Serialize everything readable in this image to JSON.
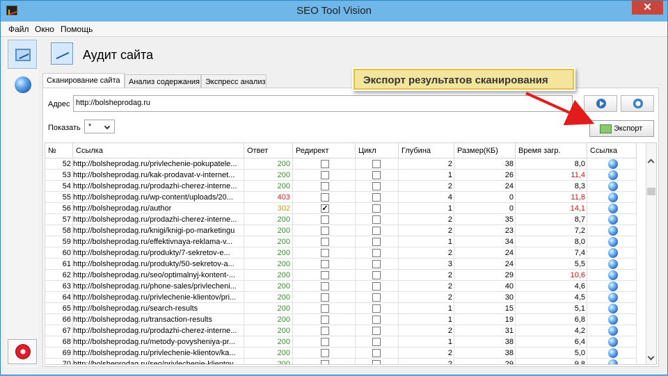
{
  "window": {
    "title": "SEO Tool Vision",
    "close": "✕"
  },
  "menu": [
    "Файл",
    "Окно",
    "Помощь"
  ],
  "header": {
    "title": "Аудит сайта"
  },
  "tabs": [
    "Сканирование сайта",
    "Анализ содержания",
    "Экспресс анализ"
  ],
  "form": {
    "address_label": "Адрес",
    "address_value": "http://bolsheprodag.ru",
    "show_label": "Показать",
    "show_value": "*",
    "export_label": "Экспорт"
  },
  "callout": {
    "text": "Экспорт результатов сканирования"
  },
  "table": {
    "headers": [
      "№",
      "Ссылка",
      "Ответ",
      "Редирект",
      "Цикл",
      "Глубина",
      "Размер(КБ)",
      "Время загр.",
      "Ссылка"
    ],
    "rows": [
      {
        "n": "52",
        "url": "http://bolsheprodag.ru/privlechenie-pokupatele...",
        "resp": "200",
        "redir": false,
        "cycle": false,
        "depth": "2",
        "size": "38",
        "time": "8,0"
      },
      {
        "n": "53",
        "url": "http://bolsheprodag.ru/kak-prodavat-v-internet...",
        "resp": "200",
        "redir": false,
        "cycle": false,
        "depth": "1",
        "size": "26",
        "time": "11,4"
      },
      {
        "n": "54",
        "url": "http://bolsheprodag.ru/prodazhi-cherez-interne...",
        "resp": "200",
        "redir": false,
        "cycle": false,
        "depth": "2",
        "size": "24",
        "time": "8,3"
      },
      {
        "n": "55",
        "url": "http://bolsheprodag.ru/wp-content/uploads/20...",
        "resp": "403",
        "redir": false,
        "cycle": false,
        "depth": "4",
        "size": "0",
        "time": "11,8"
      },
      {
        "n": "56",
        "url": "http://bolsheprodag.ru/author",
        "resp": "302",
        "redir": true,
        "cycle": false,
        "depth": "1",
        "size": "0",
        "time": "14,1"
      },
      {
        "n": "57",
        "url": "http://bolsheprodag.ru/prodazhi-cherez-interne...",
        "resp": "200",
        "redir": false,
        "cycle": false,
        "depth": "2",
        "size": "35",
        "time": "8,7"
      },
      {
        "n": "58",
        "url": "http://bolsheprodag.ru/knigi/knigi-po-marketingu",
        "resp": "200",
        "redir": false,
        "cycle": false,
        "depth": "2",
        "size": "23",
        "time": "7,2"
      },
      {
        "n": "59",
        "url": "http://bolsheprodag.ru/effektivnaya-reklama-v...",
        "resp": "200",
        "redir": false,
        "cycle": false,
        "depth": "1",
        "size": "34",
        "time": "8,0"
      },
      {
        "n": "60",
        "url": "http://bolsheprodag.ru/produkty/7-sekretov-e...",
        "resp": "200",
        "redir": false,
        "cycle": false,
        "depth": "2",
        "size": "24",
        "time": "7,4"
      },
      {
        "n": "61",
        "url": "http://bolsheprodag.ru/produkty/50-sekretov-a...",
        "resp": "200",
        "redir": false,
        "cycle": false,
        "depth": "3",
        "size": "24",
        "time": "5,5"
      },
      {
        "n": "62",
        "url": "http://bolsheprodag.ru/seo/optimalnyj-kontent-...",
        "resp": "200",
        "redir": false,
        "cycle": false,
        "depth": "2",
        "size": "29",
        "time": "10,6"
      },
      {
        "n": "63",
        "url": "http://bolsheprodag.ru/phone-sales/privlecheni...",
        "resp": "200",
        "redir": false,
        "cycle": false,
        "depth": "2",
        "size": "40",
        "time": "4,6"
      },
      {
        "n": "64",
        "url": "http://bolsheprodag.ru/privlechenie-klientov/pri...",
        "resp": "200",
        "redir": false,
        "cycle": false,
        "depth": "2",
        "size": "30",
        "time": "4,5"
      },
      {
        "n": "65",
        "url": "http://bolsheprodag.ru/search-results",
        "resp": "200",
        "redir": false,
        "cycle": false,
        "depth": "1",
        "size": "15",
        "time": "5,1"
      },
      {
        "n": "66",
        "url": "http://bolsheprodag.ru/transaction-results",
        "resp": "200",
        "redir": false,
        "cycle": false,
        "depth": "1",
        "size": "19",
        "time": "6,8"
      },
      {
        "n": "67",
        "url": "http://bolsheprodag.ru/prodazhi-cherez-interne...",
        "resp": "200",
        "redir": false,
        "cycle": false,
        "depth": "2",
        "size": "31",
        "time": "4,2"
      },
      {
        "n": "68",
        "url": "http://bolsheprodag.ru/metody-povysheniya-pr...",
        "resp": "200",
        "redir": false,
        "cycle": false,
        "depth": "1",
        "size": "38",
        "time": "6,4"
      },
      {
        "n": "69",
        "url": "http://bolsheprodag.ru/privlechenie-klientov/ka...",
        "resp": "200",
        "redir": false,
        "cycle": false,
        "depth": "2",
        "size": "38",
        "time": "5,0"
      },
      {
        "n": "70",
        "url": "http://bolsheprodag.ru/seo/privlechenie-klientov...",
        "resp": "200",
        "redir": false,
        "cycle": false,
        "depth": "2",
        "size": "29",
        "time": "9,8"
      }
    ]
  },
  "colors": {
    "status_ok": "#2c9a22",
    "status_redirect": "#c7a100",
    "status_error": "#d81f1f",
    "slow_time": "#c61515",
    "callout_arrow": "#e21b1b"
  },
  "icons": {
    "app": "app-icon",
    "rail_audit": "chart-icon",
    "rail_web": "globe-icon",
    "stop": "stop-icon",
    "play": "play-icon",
    "settings": "gear-icon",
    "export": "export-icon",
    "link": "globe-icon"
  }
}
